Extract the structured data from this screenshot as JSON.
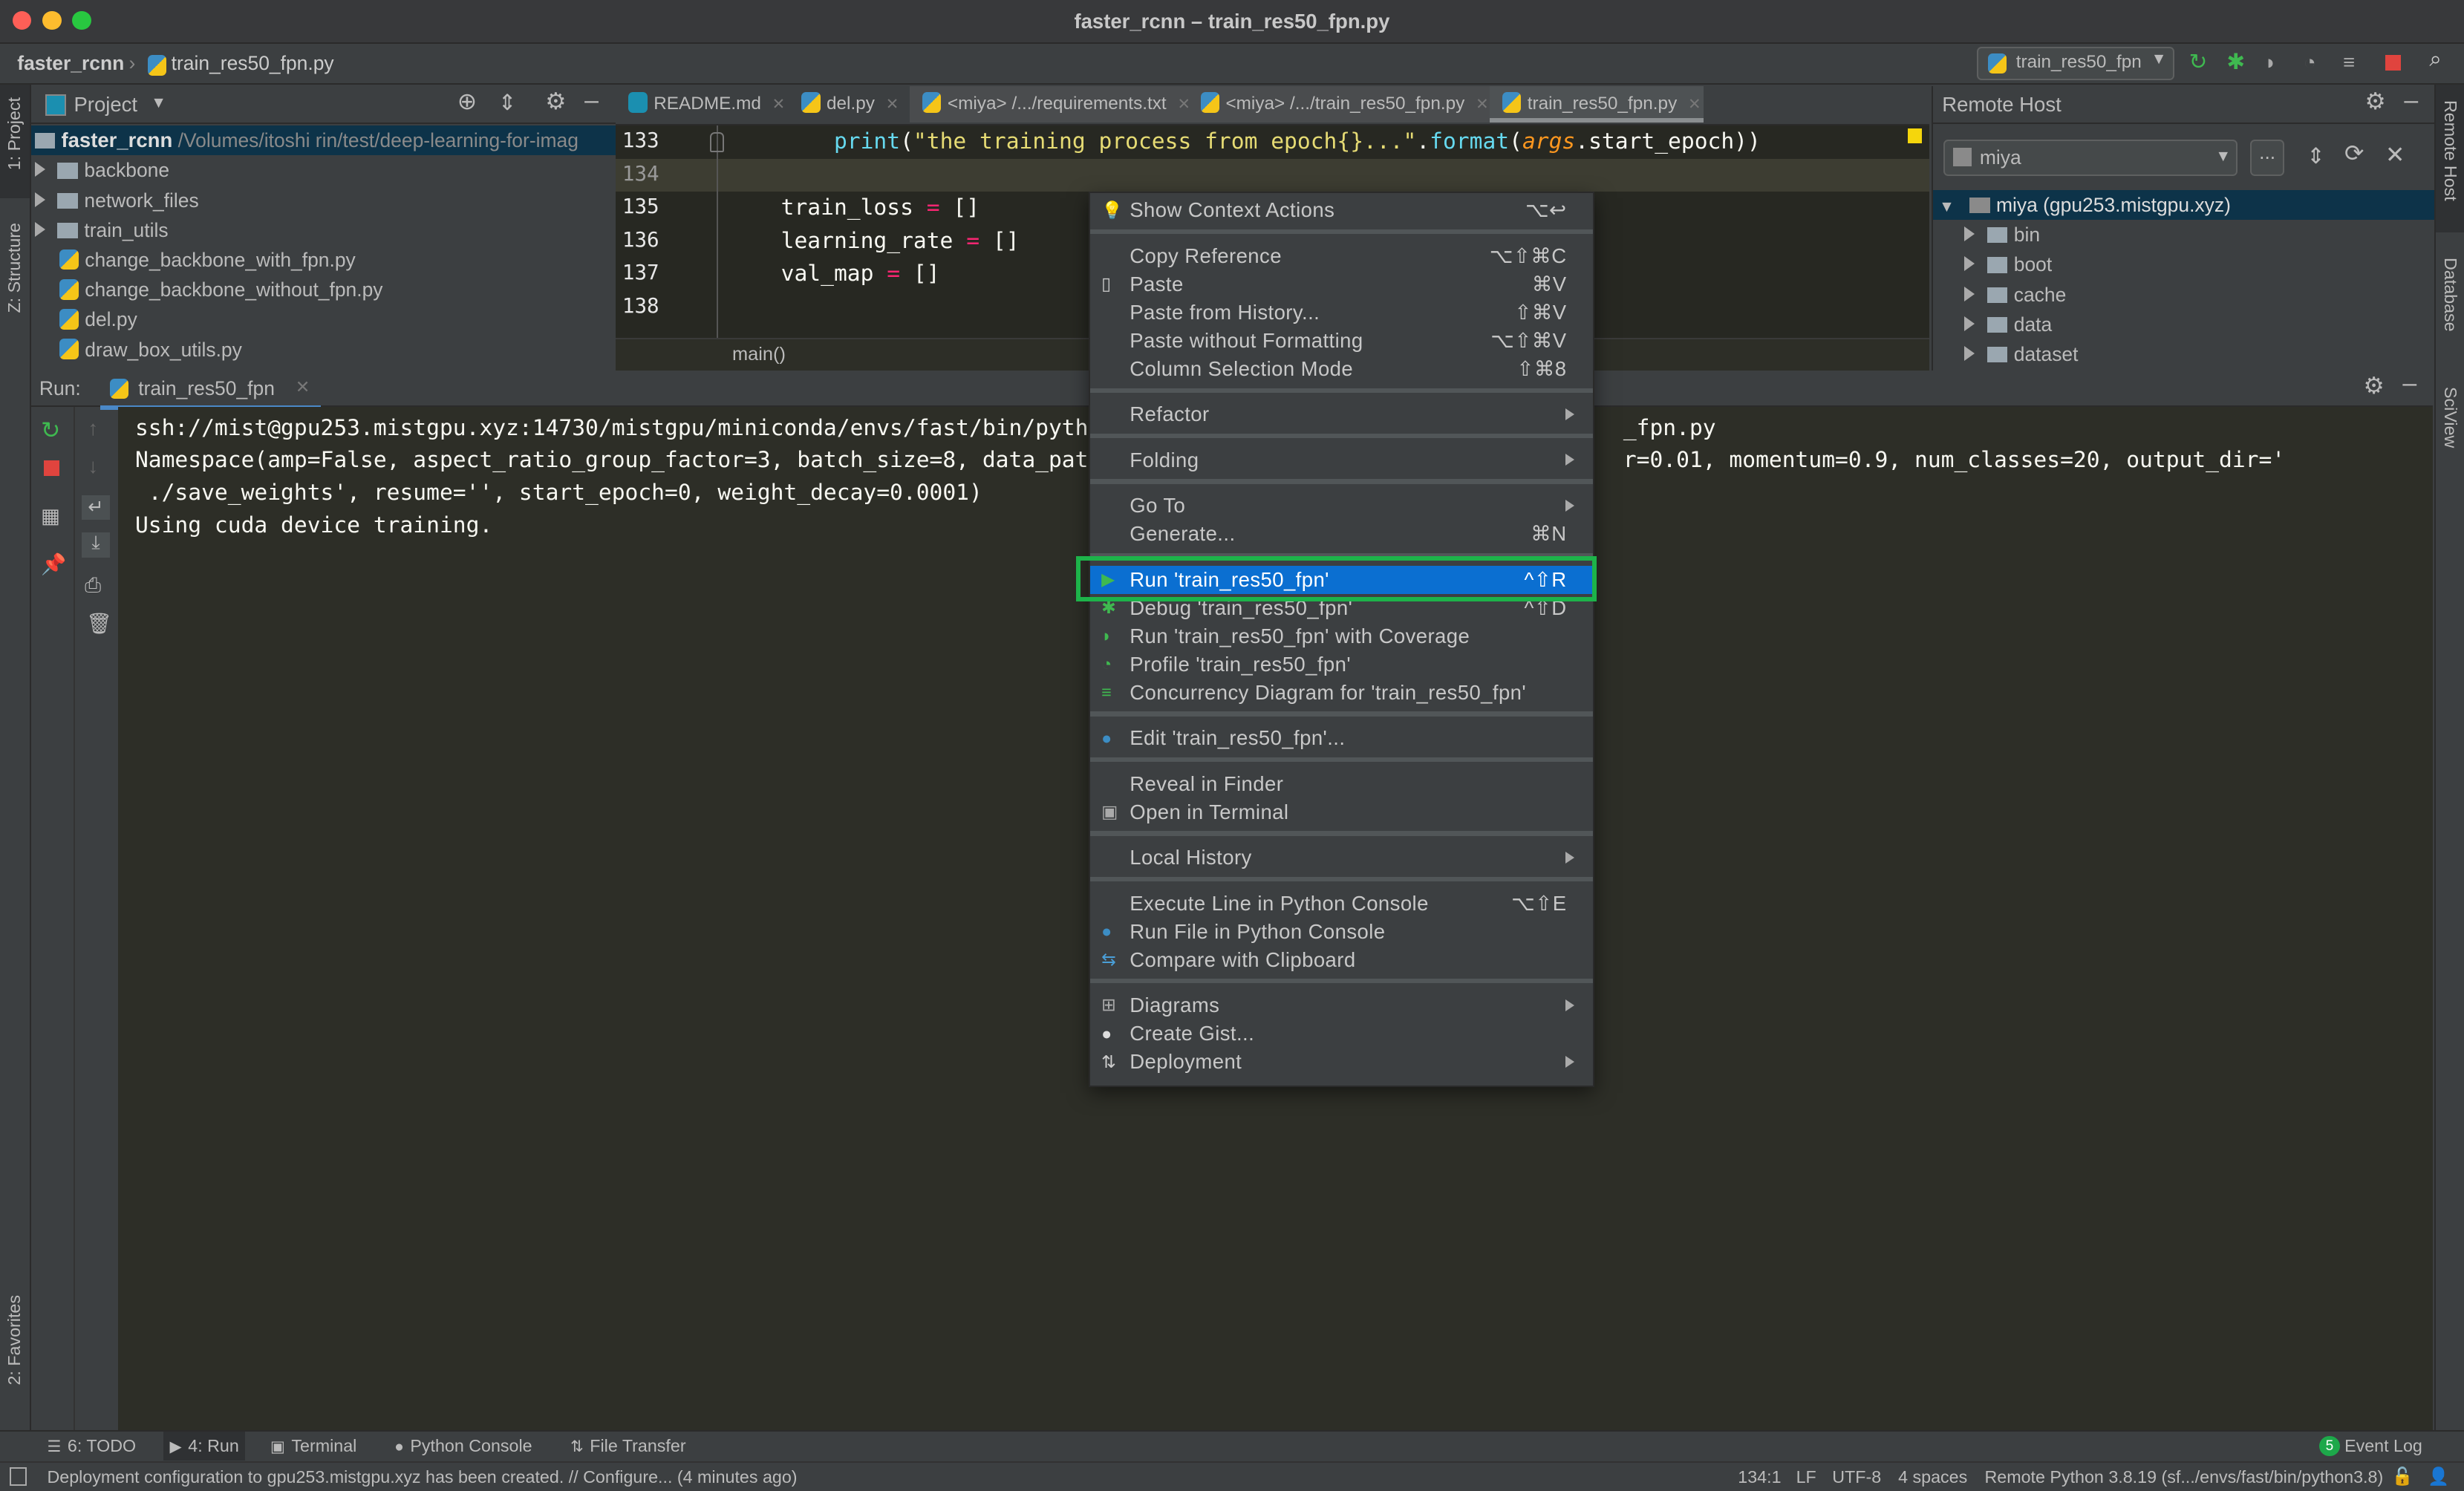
{
  "window": {
    "title": "faster_rcnn – train_res50_fpn.py"
  },
  "navbar": {
    "breadcrumb": [
      "faster_rcnn",
      "train_res50_fpn.py"
    ],
    "run_config": "train_res50_fpn"
  },
  "left_stripe": {
    "project": "1: Project",
    "structure": "Z: Structure",
    "favorites": "2: Favorites"
  },
  "right_stripe": {
    "remote_host": "Remote Host",
    "database": "Database",
    "sciview": "SciView"
  },
  "project": {
    "header": "Project",
    "root": {
      "name": "faster_rcnn",
      "path": "/Volumes/itoshi rin/test/deep-learning-for-imag"
    },
    "items": [
      {
        "name": "backbone",
        "type": "folder"
      },
      {
        "name": "network_files",
        "type": "folder"
      },
      {
        "name": "train_utils",
        "type": "folder"
      },
      {
        "name": "change_backbone_with_fpn.py",
        "type": "python"
      },
      {
        "name": "change_backbone_without_fpn.py",
        "type": "python"
      },
      {
        "name": "del.py",
        "type": "python"
      },
      {
        "name": "draw_box_utils.py",
        "type": "python"
      }
    ]
  },
  "editor": {
    "tabs": [
      {
        "label": "README.md"
      },
      {
        "label": "del.py"
      },
      {
        "label": "<miya> /.../requirements.txt"
      },
      {
        "label": "<miya> /.../train_res50_fpn.py"
      },
      {
        "label": "train_res50_fpn.py",
        "active": true
      }
    ],
    "lines": [
      {
        "num": "133",
        "code": "    print(\"the training process from epoch{}...\".format(args.start_epoch))"
      },
      {
        "num": "134",
        "code": ""
      },
      {
        "num": "135",
        "code": "train_loss = []"
      },
      {
        "num": "136",
        "code": "learning_rate = []"
      },
      {
        "num": "137",
        "code": "val_map = []"
      },
      {
        "num": "138",
        "code": ""
      }
    ],
    "breadcrumb": "main()"
  },
  "remote_host": {
    "header": "Remote Host",
    "server": "miya",
    "more": "...",
    "root": "miya (gpu253.mistgpu.xyz)",
    "items": [
      "bin",
      "boot",
      "cache",
      "data",
      "dataset"
    ]
  },
  "run": {
    "label": "Run:",
    "tab": "train_res50_fpn",
    "console": [
      {
        "left": "ssh://mist@gpu253.mistgpu.xyz:14730/mistgpu/miniconda/envs/fast/bin/pyth",
        "right": "_fpn.py"
      },
      {
        "left": "Namespace(amp=False, aspect_ratio_group_factor=3, batch_size=8, data_pat",
        "right": "r=0.01, momentum=0.9, num_classes=20, output_dir='"
      },
      {
        "left": " ./save_weights', resume='', start_epoch=0, weight_decay=0.0001)",
        "right": ""
      },
      {
        "left": "Using cuda device training.",
        "right": ""
      }
    ]
  },
  "context_menu": {
    "items": [
      {
        "label": "Show Context Actions",
        "shortcut": "⌥↩",
        "icon": "bulb-icon"
      },
      {
        "sep": true
      },
      {
        "label": "Copy Reference",
        "shortcut": "⌥⇧⌘C"
      },
      {
        "label": "Paste",
        "shortcut": "⌘V",
        "icon": "clipboard-icon"
      },
      {
        "label": "Paste from History...",
        "shortcut": "⇧⌘V"
      },
      {
        "label": "Paste without Formatting",
        "shortcut": "⌥⇧⌘V"
      },
      {
        "label": "Column Selection Mode",
        "shortcut": "⇧⌘8"
      },
      {
        "sep": true
      },
      {
        "label": "Refactor",
        "submenu": true
      },
      {
        "sep": true
      },
      {
        "label": "Folding",
        "submenu": true
      },
      {
        "sep": true
      },
      {
        "label": "Go To",
        "submenu": true
      },
      {
        "label": "Generate...",
        "shortcut": "⌘N"
      },
      {
        "sep": true
      },
      {
        "label": "Run 'train_res50_fpn'",
        "shortcut": "^⇧R",
        "icon": "run-icon",
        "selected": true
      },
      {
        "label": "Debug 'train_res50_fpn'",
        "shortcut": "^⇧D",
        "icon": "debug-icon"
      },
      {
        "label": "Run 'train_res50_fpn' with Coverage",
        "icon": "coverage-icon"
      },
      {
        "label": "Profile 'train_res50_fpn'",
        "icon": "profile-icon"
      },
      {
        "label": "Concurrency Diagram for 'train_res50_fpn'",
        "icon": "concurrency-icon"
      },
      {
        "sep": true
      },
      {
        "label": "Edit 'train_res50_fpn'...",
        "icon": "python-icon"
      },
      {
        "sep": true
      },
      {
        "label": "Reveal in Finder"
      },
      {
        "label": "Open in Terminal",
        "icon": "terminal-icon"
      },
      {
        "sep": true
      },
      {
        "label": "Local History",
        "submenu": true
      },
      {
        "sep": true
      },
      {
        "label": "Execute Line in Python Console",
        "shortcut": "⌥⇧E"
      },
      {
        "label": "Run File in Python Console",
        "icon": "python-icon"
      },
      {
        "label": "Compare with Clipboard",
        "icon": "compare-icon"
      },
      {
        "sep": true
      },
      {
        "label": "Diagrams",
        "submenu": true,
        "icon": "diagram-icon"
      },
      {
        "label": "Create Gist...",
        "icon": "github-icon"
      },
      {
        "label": "Deployment",
        "submenu": true,
        "icon": "deployment-icon"
      }
    ]
  },
  "bottom_tools": [
    {
      "label": "6: TODO"
    },
    {
      "label": "4: Run",
      "active": true
    },
    {
      "label": "Terminal"
    },
    {
      "label": "Python Console"
    },
    {
      "label": "File Transfer"
    }
  ],
  "event_log": {
    "count": "5",
    "label": "Event Log"
  },
  "status": {
    "message": "Deployment configuration to gpu253.mistgpu.xyz has been created. // Configure... (4 minutes ago)",
    "position": "134:1",
    "line_sep": "LF",
    "encoding": "UTF-8",
    "indent": "4 spaces",
    "interpreter": "Remote Python 3.8.19 (sf.../envs/fast/bin/python3.8)"
  },
  "colors": {
    "accent_selected": "#0b6fd1",
    "highlight_box": "#1db34a",
    "run_green": "#2fa84f",
    "editor_bg": "#272822"
  }
}
